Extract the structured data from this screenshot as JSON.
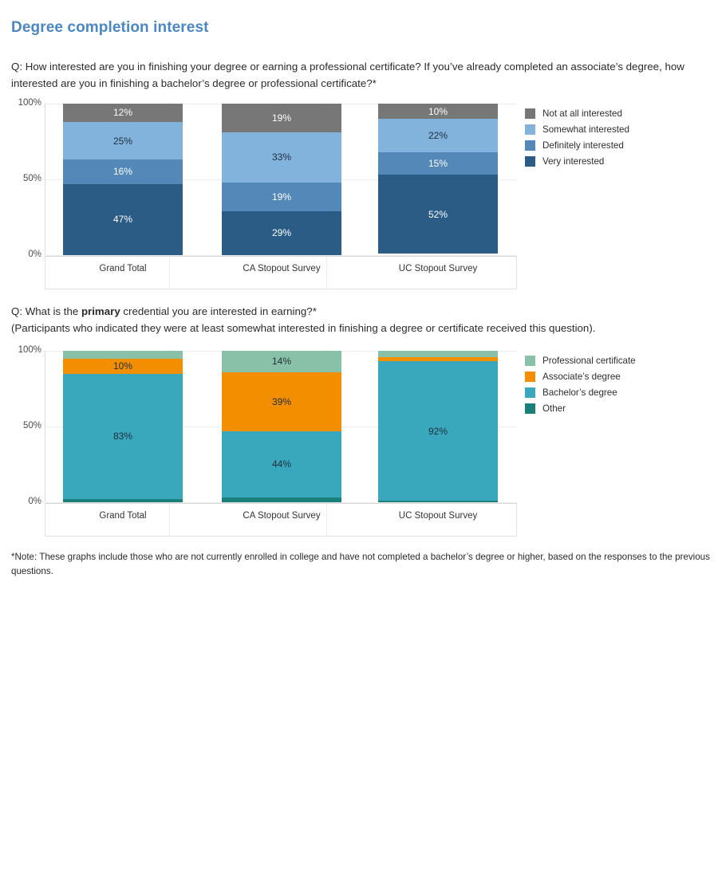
{
  "page": {
    "title": "Degree completion interest",
    "title_color": "#4a87c4",
    "note": "*Note: These graphs include those who are not currently enrolled in college and have not completed a bachelor’s degree or higher, based on the responses to the previous questions."
  },
  "question1": {
    "text": "Q: How interested are you in finishing your degree or earning a professional certificate? If you’ve already completed an associate’s degree, how interested are you in finishing a bachelor’s degree or professional certificate?*"
  },
  "question2": {
    "prefix": "Q: What is the ",
    "bold": "primary",
    "suffix": " credential you are interested in earning?*",
    "subtext": "(Participants who indicated they were at least somewhat interested in finishing a degree or certificate received this question)."
  },
  "chart_data": [
    {
      "type": "bar",
      "stacked": true,
      "normalized": true,
      "title": "Q: How interested are you in finishing your degree or earning a professional certificate? If you’ve already completed an associate’s degree, how interested are you in finishing a bachelor’s degree or professional certificate?*",
      "xlabel": "",
      "ylabel": "",
      "ylim": [
        0,
        100
      ],
      "yticks": [
        "0%",
        "50%",
        "100%"
      ],
      "grid": true,
      "legend_position": "right",
      "categories": [
        "Grand Total",
        "CA Stopout Survey",
        "UC Stopout Survey"
      ],
      "series": [
        {
          "name": "Very interested",
          "color": "#2b5c86",
          "label_color": "#ffffff",
          "values": [
            47,
            29,
            52
          ],
          "labels": [
            "47%",
            "29%",
            "52%"
          ]
        },
        {
          "name": "Definitely interested",
          "color": "#5388b8",
          "label_color": "#ffffff",
          "values": [
            16,
            19,
            15
          ],
          "labels": [
            "16%",
            "19%",
            "15%"
          ]
        },
        {
          "name": "Somewhat interested",
          "color": "#82b3dd",
          "label_color": "#1f2d3d",
          "values": [
            25,
            33,
            22
          ],
          "labels": [
            "25%",
            "33%",
            "22%"
          ]
        },
        {
          "name": "Not at all interested",
          "color": "#777777",
          "label_color": "#ffffff",
          "values": [
            12,
            19,
            10
          ],
          "labels": [
            "12%",
            "19%",
            "10%"
          ]
        }
      ],
      "legend": [
        {
          "label": "Not at all interested",
          "color": "#777777"
        },
        {
          "label": "Somewhat interested",
          "color": "#82b3dd"
        },
        {
          "label": "Definitely interested",
          "color": "#5388b8"
        },
        {
          "label": "Very interested",
          "color": "#2b5c86"
        }
      ]
    },
    {
      "type": "bar",
      "stacked": true,
      "normalized": true,
      "title": "Q: What is the primary credential you are interested in earning?*",
      "xlabel": "",
      "ylabel": "",
      "ylim": [
        0,
        100
      ],
      "yticks": [
        "0%",
        "50%",
        "100%"
      ],
      "grid": true,
      "legend_position": "right",
      "categories": [
        "Grand Total",
        "CA Stopout Survey",
        "UC Stopout Survey"
      ],
      "series": [
        {
          "name": "Other",
          "color": "#1a7f79",
          "label_color": "#ffffff",
          "values": [
            2,
            3,
            1
          ],
          "labels": [
            "",
            "",
            ""
          ]
        },
        {
          "name": "Bachelor’s degree",
          "color": "#39a8bc",
          "label_color": "#1f2d3d",
          "values": [
            83,
            44,
            92
          ],
          "labels": [
            "83%",
            "44%",
            "92%"
          ]
        },
        {
          "name": "Associate’s degree",
          "color": "#f28e00",
          "label_color": "#1f2d3d",
          "values": [
            10,
            39,
            3
          ],
          "labels": [
            "10%",
            "39%",
            ""
          ]
        },
        {
          "name": "Professional certificate",
          "color": "#89c0a8",
          "label_color": "#1f2d3d",
          "values": [
            5,
            14,
            4
          ],
          "labels": [
            "",
            "14%",
            ""
          ]
        }
      ],
      "legend": [
        {
          "label": "Professional certificate",
          "color": "#89c0a8"
        },
        {
          "label": "Associate’s degree",
          "color": "#f28e00"
        },
        {
          "label": "Bachelor’s degree",
          "color": "#39a8bc"
        },
        {
          "label": "Other",
          "color": "#1a7f79"
        }
      ]
    }
  ]
}
